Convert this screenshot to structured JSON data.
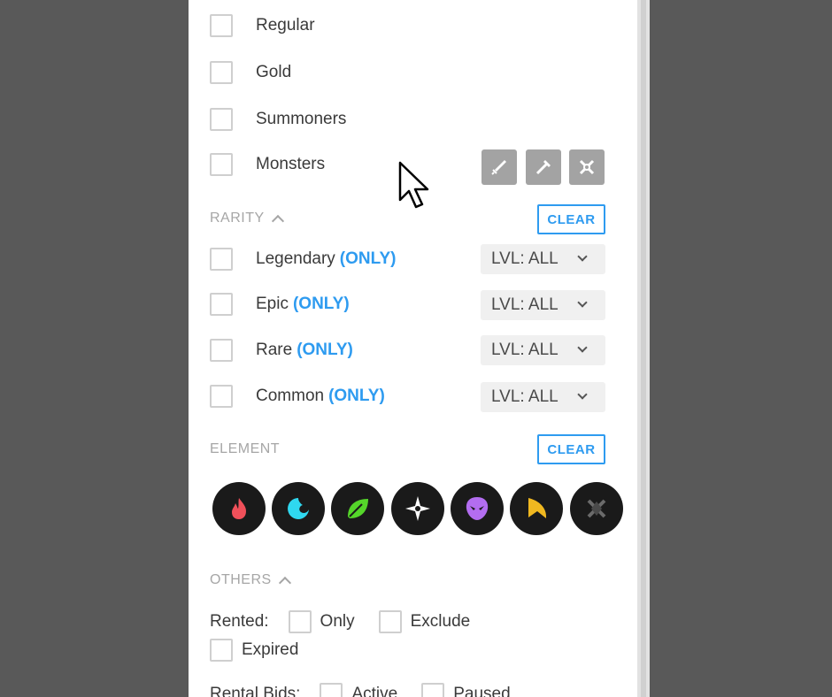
{
  "types": [
    {
      "label": "Regular"
    },
    {
      "label": "Gold"
    },
    {
      "label": "Summoners"
    },
    {
      "label": "Monsters"
    }
  ],
  "type_buttons": [
    {
      "icon": "sword-icon"
    },
    {
      "icon": "wand-icon"
    },
    {
      "icon": "crossed-swords-icon"
    }
  ],
  "rarity": {
    "heading": "RARITY",
    "clear_label": "CLEAR",
    "items": [
      {
        "label": "Legendary",
        "only": "(ONLY)",
        "level": "LVL: ALL"
      },
      {
        "label": "Epic",
        "only": "(ONLY)",
        "level": "LVL: ALL"
      },
      {
        "label": "Rare",
        "only": "(ONLY)",
        "level": "LVL: ALL"
      },
      {
        "label": "Common",
        "only": "(ONLY)",
        "level": "LVL: ALL"
      }
    ]
  },
  "element": {
    "heading": "ELEMENT",
    "clear_label": "CLEAR",
    "items": [
      {
        "icon": "fire-icon",
        "color": "#f0505a"
      },
      {
        "icon": "water-icon",
        "color": "#2fd8f0"
      },
      {
        "icon": "earth-leaf-icon",
        "color": "#55d62a"
      },
      {
        "icon": "life-star-icon",
        "color": "#ffffff"
      },
      {
        "icon": "death-skull-icon",
        "color": "#b36df0"
      },
      {
        "icon": "dragon-icon",
        "color": "#f0b820"
      },
      {
        "icon": "neutral-icon",
        "color": "#6b6b6b"
      }
    ]
  },
  "others": {
    "heading": "OTHERS",
    "rented_label": "Rented:",
    "only_label": "Only",
    "exclude_label": "Exclude",
    "expired_label": "Expired",
    "rental_bids_label": "Rental Bids:",
    "active_label": "Active",
    "paused_label": "Paused"
  },
  "colors": {
    "accent": "#2e9bf0",
    "backdrop": "#595959"
  }
}
